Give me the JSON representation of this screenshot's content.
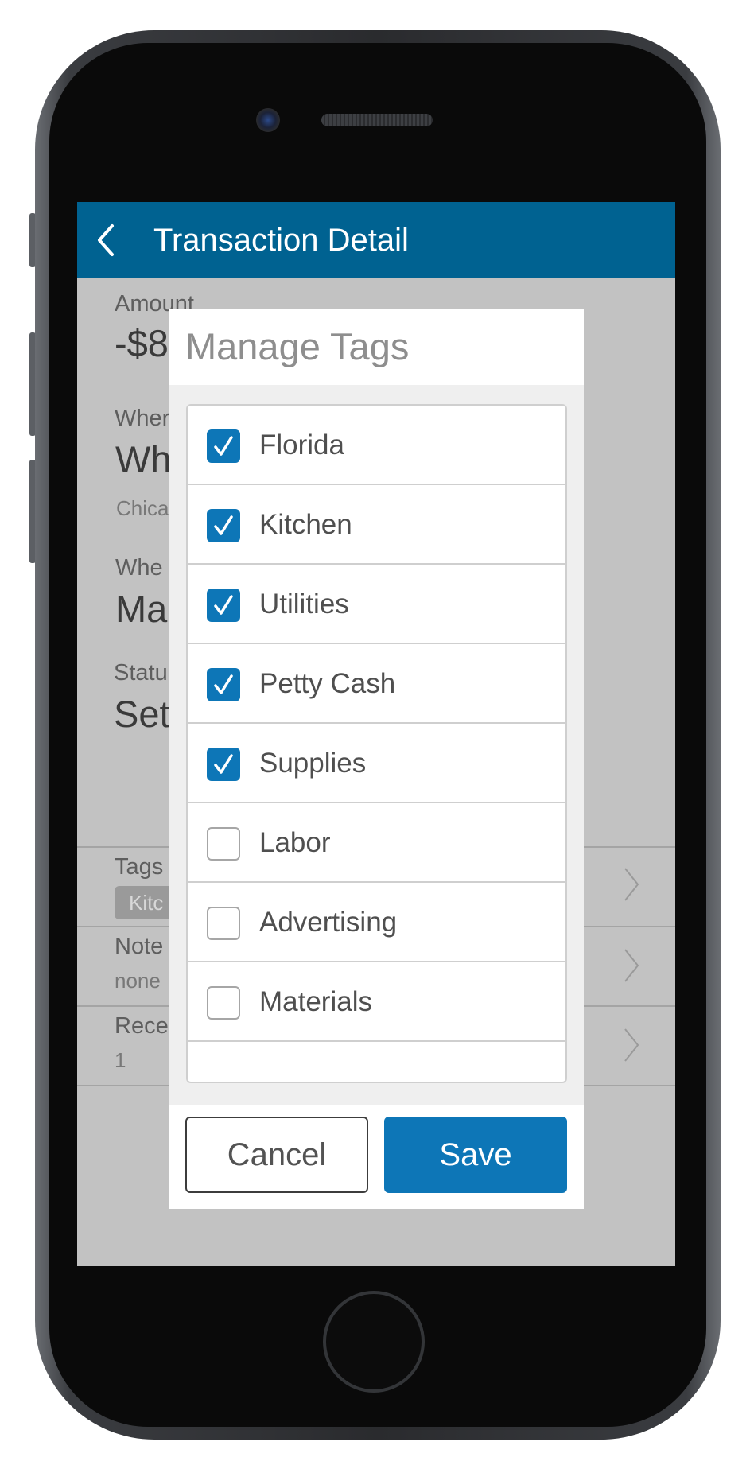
{
  "colors": {
    "appbar": "#006291",
    "accent": "#0d76b7",
    "dimmed_background": "#c2c2c2"
  },
  "appbar": {
    "title": "Transaction Detail",
    "back_icon": "chevron-left-icon"
  },
  "detail": {
    "amount_label": "Amount",
    "amount_value": "-$8",
    "where_label": "Wher",
    "where_value": "Who",
    "where_location": "Chica",
    "when_label": "Whe",
    "when_value": "Ma",
    "status_label": "Statu",
    "status_value": "Set"
  },
  "rows": {
    "tags_label": "Tags",
    "tags_chip": "Kitc",
    "notes_label": "Note",
    "notes_value": "none",
    "receipts_label": "Rece",
    "receipts_value": "1"
  },
  "dialog": {
    "title": "Manage Tags",
    "tags": [
      {
        "label": "Florida",
        "checked": true
      },
      {
        "label": "Kitchen",
        "checked": true
      },
      {
        "label": "Utilities",
        "checked": true
      },
      {
        "label": "Petty Cash",
        "checked": true
      },
      {
        "label": "Supplies",
        "checked": true
      },
      {
        "label": "Labor",
        "checked": false
      },
      {
        "label": "Advertising",
        "checked": false
      },
      {
        "label": "Materials",
        "checked": false
      }
    ],
    "cancel_label": "Cancel",
    "save_label": "Save"
  }
}
